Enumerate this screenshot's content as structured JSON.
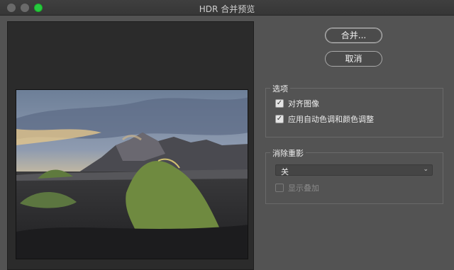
{
  "window": {
    "title": "HDR 合并预览"
  },
  "buttons": {
    "merge": "合并...",
    "cancel": "取消"
  },
  "options_group": {
    "title": "选项",
    "items": [
      {
        "label": "对齐图像",
        "checked": true
      },
      {
        "label": "应用自动色调和颜色调整",
        "checked": true
      }
    ]
  },
  "ghost_group": {
    "title": "消除重影",
    "select_value": "关",
    "overlay": {
      "label": "显示叠加",
      "checked": false,
      "enabled": false
    }
  },
  "colors": {
    "traffic_green": "#27c93f",
    "panel_bg": "#535353",
    "preview_bg": "#2b2b2b"
  },
  "icons": {
    "check": "✓",
    "dropdown": "⌄"
  }
}
